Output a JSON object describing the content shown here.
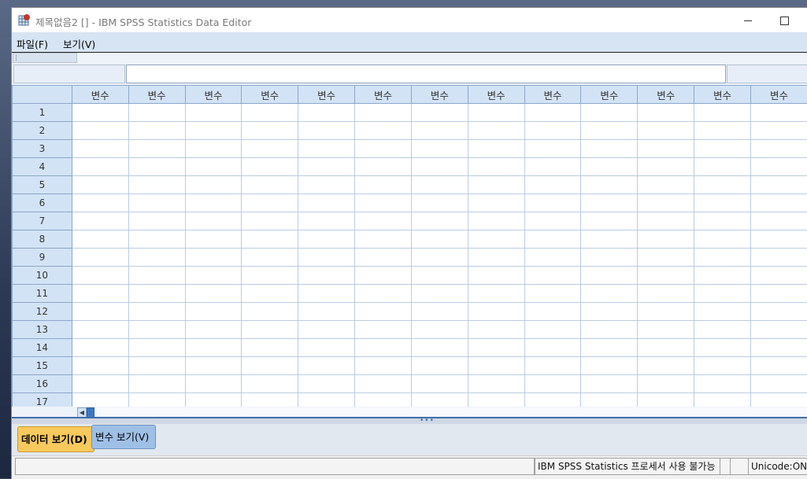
{
  "window": {
    "title": "제목없음2 [] - IBM SPSS Statistics Data Editor",
    "minimize_symbol": "—",
    "maximize_symbol": "☐"
  },
  "menu": {
    "items": [
      {
        "label": "파일(F)"
      },
      {
        "label": "보기(V)"
      }
    ]
  },
  "grid": {
    "column_header": "변수",
    "columns": 13,
    "rows": [
      "1",
      "2",
      "3",
      "4",
      "5",
      "6",
      "7",
      "8",
      "9",
      "10",
      "11",
      "12",
      "13",
      "14",
      "15",
      "16",
      "17"
    ]
  },
  "tabs": {
    "data_view": "데이터 보기(D)",
    "variable_view": "변수 보기(V)"
  },
  "statusbar": {
    "processor": "IBM SPSS Statistics 프로세서 사용 불가능",
    "unicode": "Unicode:ON"
  },
  "colors": {
    "header_bg": "#d3e3f6",
    "active_tab": "#f8c95c",
    "inactive_tab": "#9fc0e6",
    "menubar_bg": "#d6e4f4"
  }
}
